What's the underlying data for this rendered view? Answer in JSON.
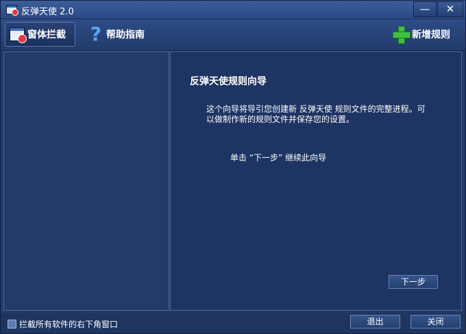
{
  "window": {
    "title": "反弹天使 2.0",
    "minimize_glyph": "—",
    "close_glyph": "✕"
  },
  "toolbar": {
    "block_window_label": "窗体拦截",
    "help_label": "帮助指南",
    "new_rule_label": "新增规则"
  },
  "wizard": {
    "title": "反弹天使规则向导",
    "description": "这个向导将导引您创建新 反弹天使 规则文件的完整进程。可以做制作新的规则文件并保存您的设置。",
    "hint": "单击 “下一步” 继续此向导",
    "next_label": "下一步"
  },
  "status": {
    "checkbox_label": "拦截所有软件的右下角窗口",
    "exit_label": "退出",
    "close_label": "关闭"
  },
  "icons": {
    "app": "app-window-icon",
    "block": "window-block-icon",
    "help": "question-mark-icon",
    "add": "green-plus-icon"
  }
}
